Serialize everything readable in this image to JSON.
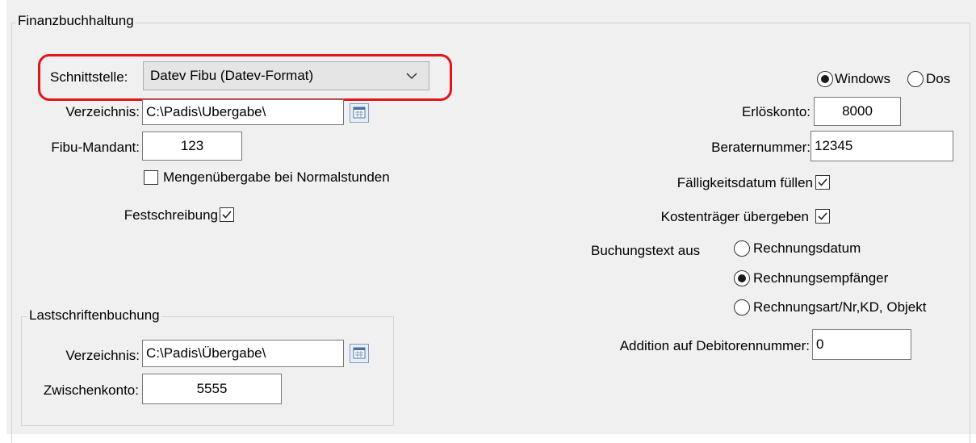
{
  "finanz": {
    "title": "Finanzbuchhaltung",
    "schnittstelle_label": "Schnittstelle:",
    "schnittstelle_value": "Datev Fibu (Datev-Format)",
    "verzeichnis_label": "Verzeichnis:",
    "verzeichnis_value": "C:\\Padis\\Ubergabe\\",
    "mandant_label": "Fibu-Mandant:",
    "mandant_value": "123",
    "mengen_label": "Mengenübergabe bei Normalstunden",
    "mengen_checked": false,
    "fest_label": "Festschreibung",
    "fest_checked": true
  },
  "os": {
    "windows_label": "Windows",
    "dos_label": "Dos",
    "selected": "Windows"
  },
  "right": {
    "erloes_label": "Erlöskonto:",
    "erloes_value": "8000",
    "berater_label": "Beraternummer:",
    "berater_value": "12345",
    "faellig_label": "Fälligkeitsdatum füllen",
    "faellig_checked": true,
    "kosten_label": "Kostenträger übergeben",
    "kosten_checked": true,
    "buchung_label": "Buchungstext aus",
    "buchung_options": [
      "Rechnungsdatum",
      "Rechnungsempfänger",
      "Rechnungsart/Nr,KD, Objekt"
    ],
    "buchung_selected": "Rechnungsempfänger",
    "addition_label": "Addition auf Debitorennummer:",
    "addition_value": "0"
  },
  "lastschrift": {
    "title": "Lastschriftenbuchung",
    "verzeichnis_label": "Verzeichnis:",
    "verzeichnis_value": "C:\\Padis\\Übergabe\\",
    "zwischen_label": "Zwischenkonto:",
    "zwischen_value": "5555"
  },
  "icons": {
    "browse": "folder-browse-icon",
    "dropdown": "chevron-down-icon"
  },
  "colors": {
    "panel": "#f0f0f0",
    "highlight": "#e0161b"
  }
}
